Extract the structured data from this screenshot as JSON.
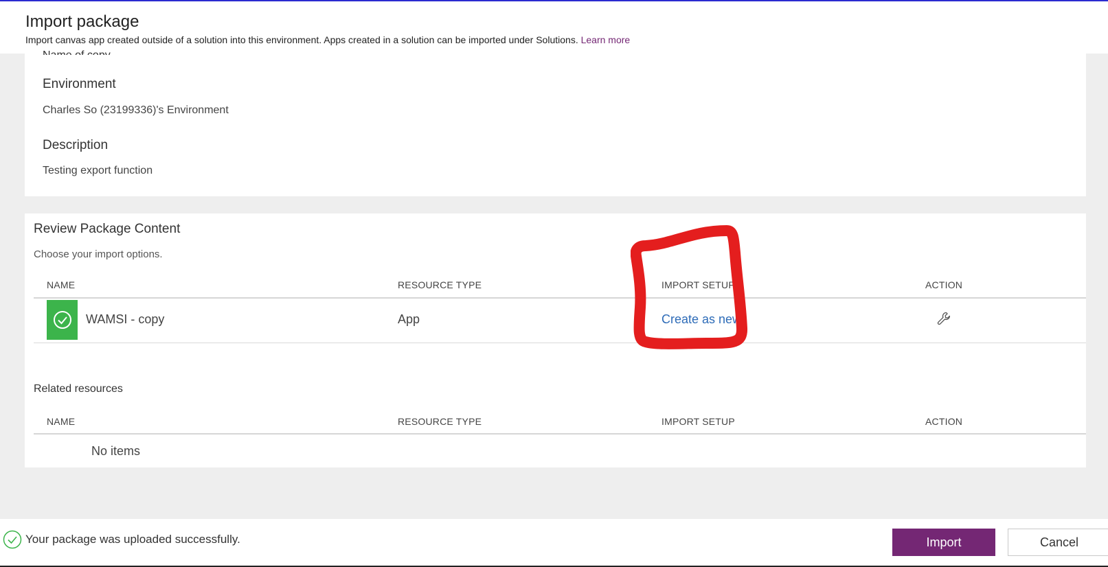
{
  "header": {
    "title": "Import package",
    "subtitle": "Import canvas app created outside of a solution into this environment. Apps created in a solution can be imported under Solutions.",
    "learn_more": "Learn more"
  },
  "details": {
    "cropped_label": "Name of copy",
    "environment_label": "Environment",
    "environment_value": "Charles So (23199336)'s Environment",
    "description_label": "Description",
    "description_value": "Testing export function"
  },
  "review": {
    "title": "Review Package Content",
    "subtitle": "Choose your import options.",
    "columns": [
      "NAME",
      "RESOURCE TYPE",
      "IMPORT SETUP",
      "ACTION"
    ],
    "rows": [
      {
        "name": "WAMSI - copy",
        "resource_type": "App",
        "import_setup": "Create as new",
        "action_icon": "wrench-icon",
        "status_icon": "check-circle-icon"
      }
    ]
  },
  "related": {
    "title": "Related resources",
    "columns": [
      "NAME",
      "RESOURCE TYPE",
      "IMPORT SETUP",
      "ACTION"
    ],
    "empty_text": "No items"
  },
  "footer": {
    "status_text": "Your package was uploaded successfully.",
    "import_label": "Import",
    "cancel_label": "Cancel"
  },
  "colors": {
    "accent": "#742774",
    "success": "#3cb44b",
    "link": "#2e6cb8",
    "annotation": "#e41e1e"
  }
}
